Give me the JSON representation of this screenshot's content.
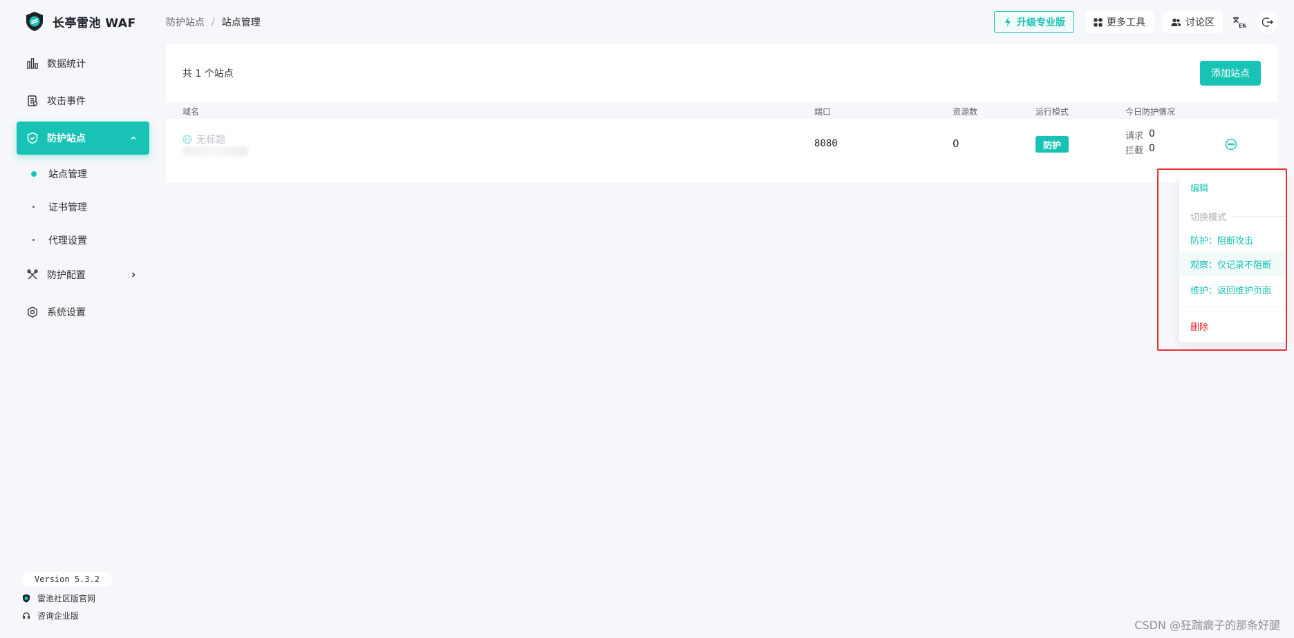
{
  "app": {
    "title": "长亭雷池 WAF"
  },
  "sidebar": {
    "items": [
      {
        "label": "数据统计",
        "icon": "bar-chart-icon"
      },
      {
        "label": "攻击事件",
        "icon": "document-icon"
      },
      {
        "label": "防护站点",
        "icon": "shield-icon"
      },
      {
        "label": "防护配置",
        "icon": "tools-icon"
      },
      {
        "label": "系统设置",
        "icon": "gear-icon"
      }
    ],
    "sub_items": [
      {
        "label": "站点管理"
      },
      {
        "label": "证书管理"
      },
      {
        "label": "代理设置"
      }
    ],
    "version": "Version 5.3.2",
    "links": [
      {
        "label": "雷池社区版官网",
        "icon": "shield-small-icon"
      },
      {
        "label": "咨询企业版",
        "icon": "headset-icon"
      }
    ]
  },
  "header": {
    "breadcrumb": [
      "防护站点",
      "站点管理"
    ],
    "separator": "/",
    "buttons": {
      "upgrade": "升级专业版",
      "tools": "更多工具",
      "forum": "讨论区"
    },
    "lang_switch": "EN"
  },
  "sites": {
    "total_text": "共 1 个站点",
    "add_button": "添加站点",
    "columns": [
      "域名",
      "端口",
      "资源数",
      "运行模式",
      "今日防护情况"
    ],
    "rows": [
      {
        "domain_placeholder": "无标题",
        "port": "8080",
        "resources": "0",
        "mode": "防护",
        "request_label": "请求",
        "request_count": "0",
        "block_label": "拦截",
        "block_count": "0"
      }
    ]
  },
  "dropdown": {
    "edit": "编辑",
    "group_label": "切换模式",
    "modes": [
      "防护：阻断攻击",
      "观察：仅记录不阻断",
      "维护：返回维护页面"
    ],
    "delete": "删除"
  },
  "watermark": "CSDN @狂踹瘸子的那条好腿",
  "colors": {
    "accent": "#18c2b4",
    "danger": "#f5222d",
    "highlight_frame": "#e62e2e"
  }
}
